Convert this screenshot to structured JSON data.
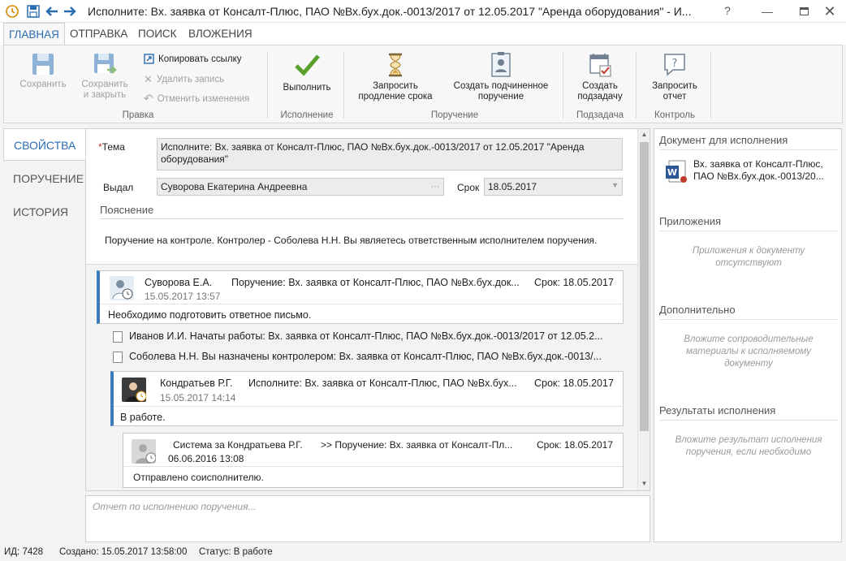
{
  "window": {
    "title": "Исполните: Вх. заявка от Консалт-Плюс, ПАО №Вх.бух.док.-0013/2017 от 12.05.2017 \"Аренда оборудования\" - И..."
  },
  "ribbon_tabs": [
    "ГЛАВНАЯ",
    "ОТПРАВКА",
    "ПОИСК",
    "ВЛОЖЕНИЯ"
  ],
  "ribbon": {
    "save": "Сохранить",
    "save_close_1": "Сохранить",
    "save_close_2": "и закрыть",
    "copy_link": "Копировать ссылку",
    "delete": "Удалить запись",
    "undo": "Отменить изменения",
    "group_edit": "Правка",
    "execute": "Выполнить",
    "group_exec": "Исполнение",
    "extend_1": "Запросить",
    "extend_2": "продление срока",
    "create_sub_1": "Создать подчиненное",
    "create_sub_2": "поручение",
    "group_order": "Поручение",
    "subtask_1": "Создать",
    "subtask_2": "подзадачу",
    "group_subtask": "Подзадача",
    "report_1": "Запросить",
    "report_2": "отчет",
    "group_control": "Контроль"
  },
  "nav": [
    "СВОЙСТВА",
    "ПОРУЧЕНИЕ",
    "ИСТОРИЯ"
  ],
  "form": {
    "topic_label": "Тема",
    "topic_star": "*",
    "topic_line1": "Исполните: Вх. заявка от Консалт-Плюс, ПАО №Вх.бух.док.-0013/2017 от 12.05.2017 \"Аренда",
    "topic_line2": "оборудования\"",
    "issued_label": "Выдал",
    "issued_value": "Суворова Екатерина Андреевна",
    "issued_dots": "···",
    "due_label": "Срок",
    "due_value": "18.05.2017",
    "note_label": "Пояснение",
    "note_text": "Поручение на контроле. Контролер - Соболева Н.Н. Вы являетесь ответственным исполнителем поручения."
  },
  "thread": {
    "c1": {
      "who": "Суворова Е.А.",
      "subject": "Поручение: Вх. заявка от Консалт-Плюс, ПАО №Вх.бух.док...",
      "due": "Срок: 18.05.2017",
      "date": "15.05.2017 13:57",
      "body": "Необходимо подготовить ответное письмо."
    },
    "e1": "Иванов И.И. Начаты работы: Вх. заявка от Консалт-Плюс, ПАО №Вх.бух.док.-0013/2017 от 12.05.2...",
    "e2": "Соболева Н.Н. Вы назначены контролером: Вх. заявка от Консалт-Плюс, ПАО №Вх.бух.док.-0013/...",
    "c2": {
      "who": "Кондратьев Р.Г.",
      "subject": "Исполните: Вх. заявка от Консалт-Плюс, ПАО №Вх.бух...",
      "due": "Срок: 18.05.2017",
      "date": "15.05.2017 14:14",
      "body": "В работе."
    },
    "c3": {
      "who": "Система за Кондратьева Р.Г.",
      "subject": ">> Поручение: Вх. заявка от Консалт-Пл...",
      "due": "Срок: 18.05.2017",
      "date": "06.06.2016 13:08",
      "body": "Отправлено соисполнителю."
    }
  },
  "report_placeholder": "Отчет по исполнению поручения...",
  "right": {
    "doc_head": "Документ для исполнения",
    "doc_line1": "Вх. заявка от Консалт-Плюс,",
    "doc_line2": "ПАО №Вх.бух.док.-0013/20...",
    "att_head": "Приложения",
    "att_hint": "Приложения к документу отсутствуют",
    "extra_head": "Дополнительно",
    "extra_hint": "Вложите сопроводительные материалы к исполняемому документу",
    "results_head": "Результаты исполнения",
    "results_hint": "Вложите результат исполнения поручения, если необходимо"
  },
  "status": {
    "id": "ИД: 7428",
    "created": "Создано: 15.05.2017 13:58:00",
    "state": "Статус: В работе"
  },
  "colors": {
    "accent": "#2b6cb0",
    "card_bar": "#3d7bbf",
    "check": "#5aa02c"
  }
}
